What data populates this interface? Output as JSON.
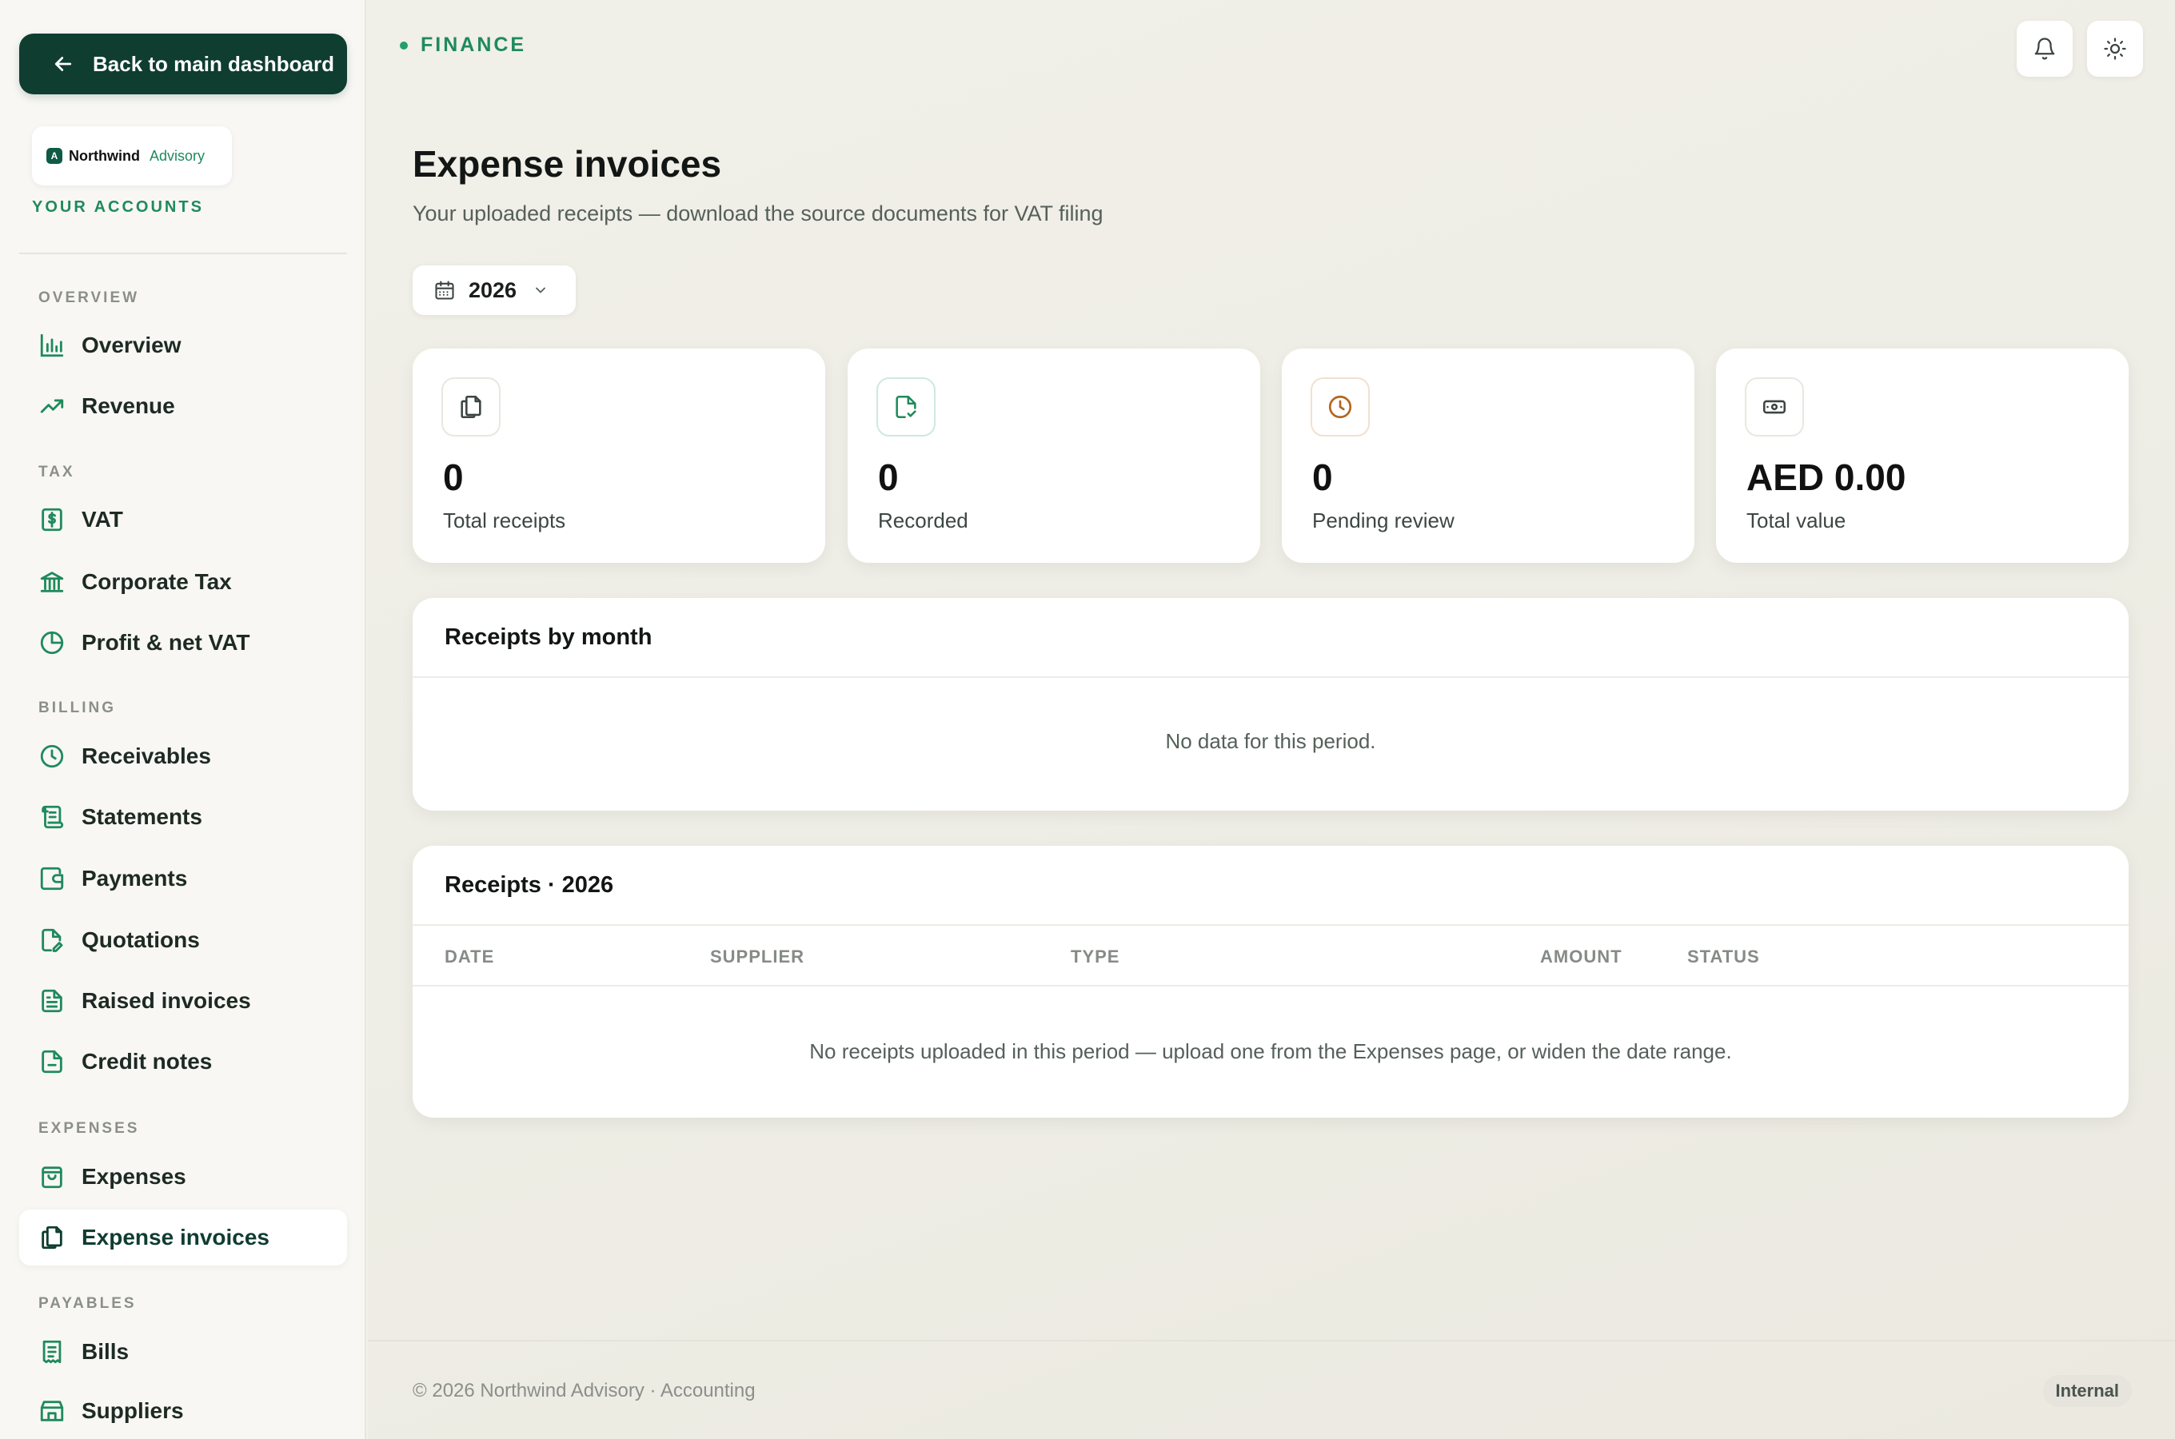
{
  "sidebar": {
    "back_label": "Back to main dashboard",
    "brand_name": "Northwind",
    "brand_sub": "Advisory",
    "accounts_label": "YOUR ACCOUNTS",
    "sections": {
      "overview": "OVERVIEW",
      "tax": "TAX",
      "billing": "BILLING",
      "expenses": "EXPENSES",
      "payables": "PAYABLES"
    },
    "items": {
      "overview": "Overview",
      "revenue": "Revenue",
      "vat": "VAT",
      "corporate_tax": "Corporate Tax",
      "profit_net_vat": "Profit & net VAT",
      "receivables": "Receivables",
      "statements": "Statements",
      "payments": "Payments",
      "quotations": "Quotations",
      "raised_invoices": "Raised invoices",
      "credit_notes": "Credit notes",
      "expenses": "Expenses",
      "expense_invoices": "Expense invoices",
      "bills": "Bills",
      "suppliers": "Suppliers"
    },
    "active_item": "expense_invoices"
  },
  "header": {
    "section": "FINANCE",
    "title": "Expense invoices",
    "subtitle": "Your uploaded receipts — download the source documents for VAT filing",
    "year": "2026"
  },
  "stats": {
    "total_receipts": {
      "value": "0",
      "label": "Total receipts"
    },
    "recorded": {
      "value": "0",
      "label": "Recorded"
    },
    "pending_review": {
      "value": "0",
      "label": "Pending review"
    },
    "total_value": {
      "value": "AED 0.00",
      "label": "Total value"
    }
  },
  "receipts_by_month": {
    "title": "Receipts by month",
    "empty": "No data for this period."
  },
  "receipts_table": {
    "title": "Receipts · 2026",
    "columns": {
      "date": "DATE",
      "supplier": "SUPPLIER",
      "type": "TYPE",
      "amount": "AMOUNT",
      "status": "STATUS"
    },
    "empty": "No receipts uploaded in this period — upload one from the Expenses page, or widen the date range."
  },
  "footer": {
    "copyright": "© 2026 Northwind Advisory · Accounting",
    "badge": "Internal"
  },
  "colors": {
    "accent": "#1f8a5c",
    "dark_green": "#0f3d30",
    "pending": "#b5651d"
  }
}
